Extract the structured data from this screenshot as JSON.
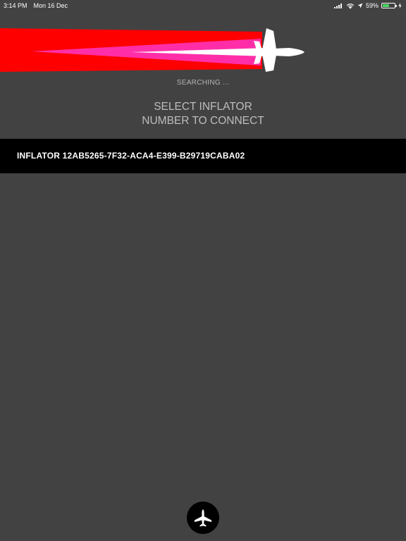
{
  "status_bar": {
    "time": "3:14 PM",
    "date": "Mon 16 Dec",
    "battery_text": "59%",
    "battery_level": 0.59,
    "battery_color": "#4cd964",
    "icons": [
      "cellular-signal-icon",
      "wifi-icon",
      "location-arrow-icon",
      "battery-icon",
      "charging-bolt-icon"
    ]
  },
  "banner": {
    "icon": "jet-contrail-logo-icon",
    "colors": {
      "contrail_outer": "#ff0000",
      "contrail_middle": "#ff2ea8",
      "contrail_core": "#ffffff",
      "jet": "#ffffff"
    }
  },
  "main": {
    "status_text": "SEARCHING ...",
    "instruction_line1": "SELECT INFLATOR",
    "instruction_line2": "NUMBER TO CONNECT"
  },
  "devices": [
    {
      "label": "INFLATOR 12AB5265-7F32-ACA4-E399-B29719CABA02"
    }
  ],
  "bottom_button": {
    "icon": "airplane-icon"
  },
  "colors": {
    "background": "#424242",
    "row_background": "#000000",
    "text_muted": "#bdbdbd",
    "text_white": "#ffffff"
  }
}
